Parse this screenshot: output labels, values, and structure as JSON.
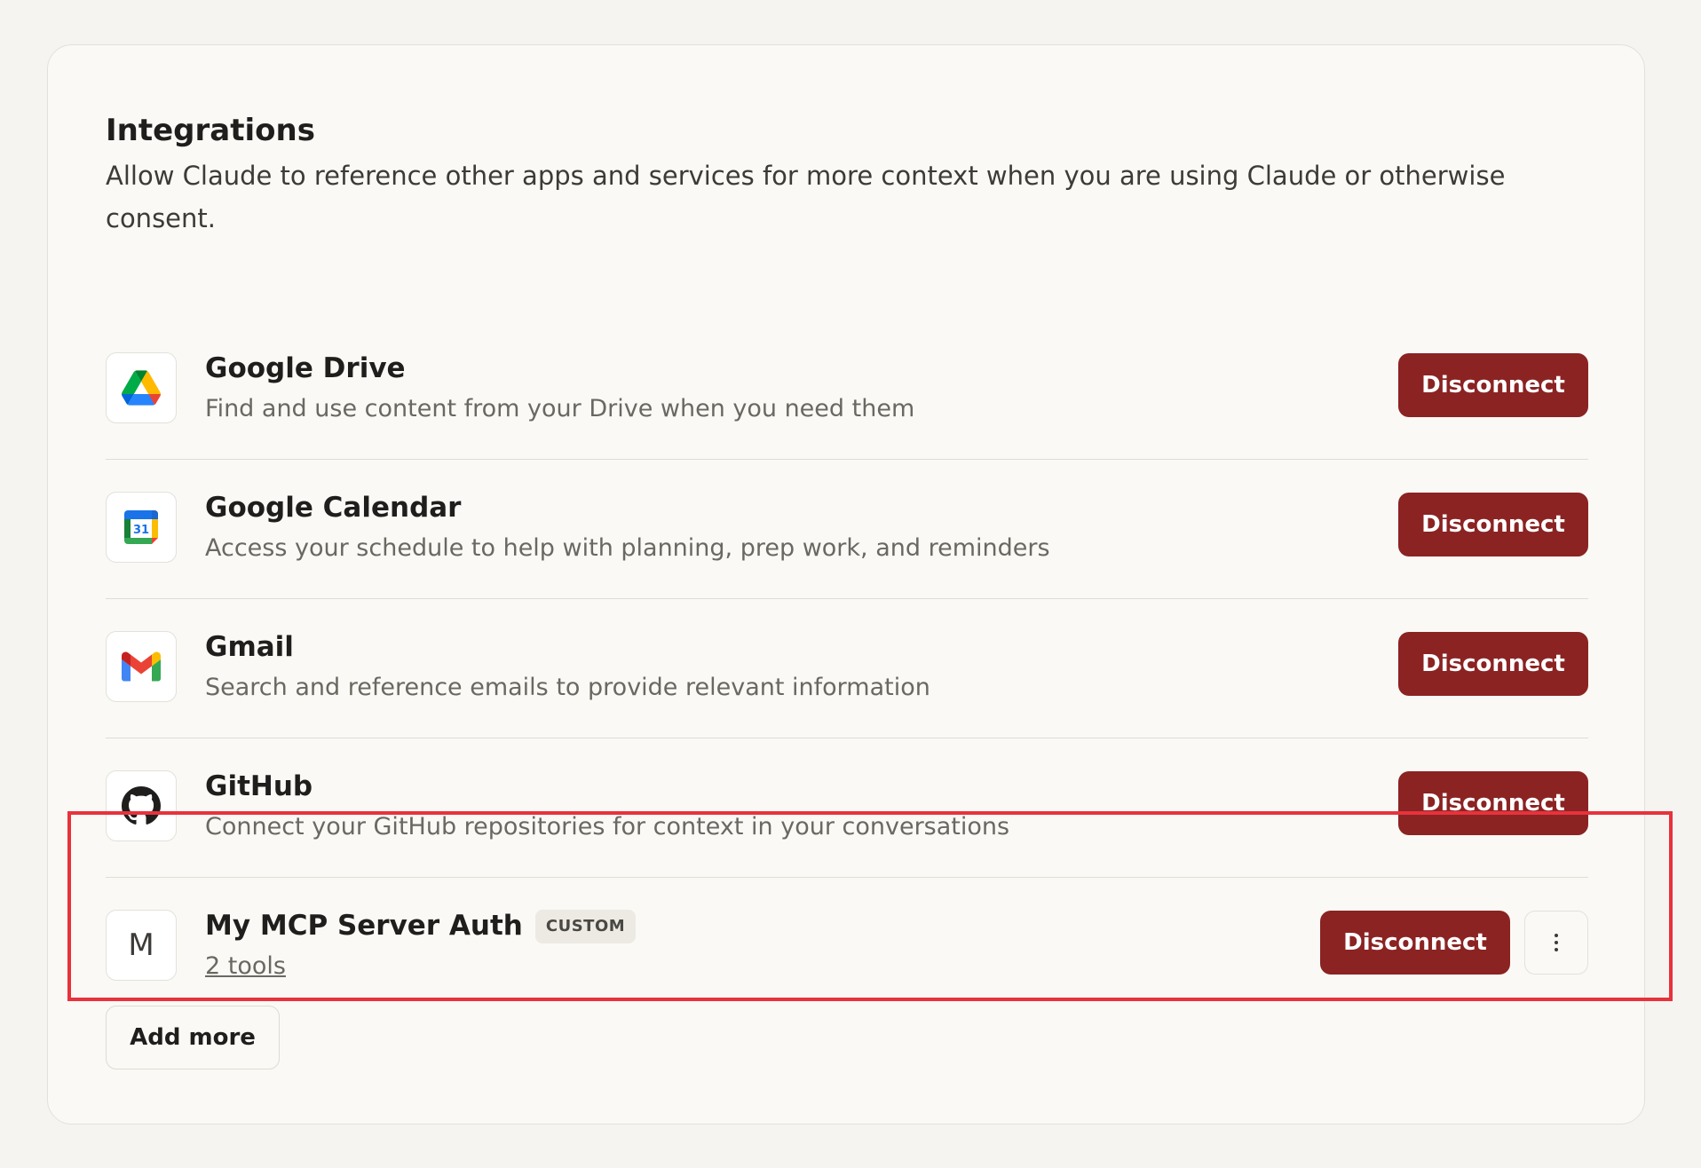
{
  "section": {
    "title": "Integrations",
    "description": "Allow Claude to reference other apps and services for more context when you are using Claude or otherwise consent."
  },
  "integrations": [
    {
      "name": "Google Drive",
      "description": "Find and use content from your Drive when you need them",
      "icon": "google-drive-icon",
      "action_label": "Disconnect"
    },
    {
      "name": "Google Calendar",
      "description": "Access your schedule to help with planning, prep work, and reminders",
      "icon": "google-calendar-icon",
      "action_label": "Disconnect",
      "icon_text": "31"
    },
    {
      "name": "Gmail",
      "description": "Search and reference emails to provide relevant information",
      "icon": "gmail-icon",
      "action_label": "Disconnect"
    },
    {
      "name": "GitHub",
      "description": "Connect your GitHub repositories for context in your conversations",
      "icon": "github-icon",
      "action_label": "Disconnect"
    },
    {
      "name": "My MCP Server Auth",
      "badge": "CUSTOM",
      "icon_letter": "M",
      "tools_link": "2 tools",
      "action_label": "Disconnect",
      "more_icon": "more-vertical-icon"
    }
  ],
  "add_more_label": "Add more",
  "colors": {
    "disconnect_button": "#8b2323",
    "highlight_border": "#e8323c",
    "card_background": "#faf9f5"
  }
}
